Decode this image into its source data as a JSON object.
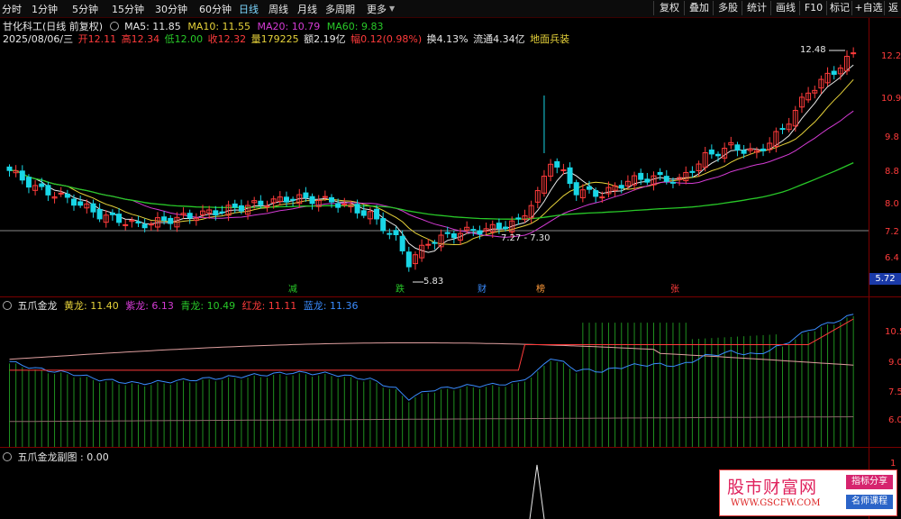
{
  "toolbar": {
    "periods": [
      "分时",
      "1分钟",
      "5分钟",
      "15分钟",
      "30分钟",
      "60分钟",
      "日线",
      "周线",
      "月线",
      "多周期",
      "更多"
    ],
    "active_period": "日线",
    "right_buttons": [
      "复权",
      "叠加",
      "多股",
      "统计",
      "画线",
      "F10",
      "标记",
      "+自选",
      "返回"
    ]
  },
  "header": {
    "stock": "甘化科工(日线 前复权)",
    "ma5_label": "MA5: 11.85",
    "ma10_label": "MA10: 11.55",
    "ma20_label": "MA20: 10.79",
    "ma60_label": "MA60: 9.83",
    "date": "2025/08/06/三",
    "open": "开12.11",
    "high": "高12.34",
    "low": "低12.00",
    "close": "收12.32",
    "volume": "量179225",
    "amount": "额2.19亿",
    "change": "幅0.12(0.98%)",
    "turnover": "换4.13%",
    "float_cap": "流通4.34亿",
    "signal": "地面兵装"
  },
  "main_chart": {
    "price_axis": [
      "12.2",
      "10.9",
      "9.8",
      "8.8",
      "8.0",
      "7.2",
      "6.4"
    ],
    "current_price_tag": "5.72",
    "annotations": {
      "high": "12.48",
      "low": "5.83",
      "range": "7.27 - 7.30"
    },
    "events": [
      "减",
      "跌",
      "财",
      "榜",
      "张"
    ]
  },
  "indicator": {
    "title": "五爪金龙",
    "yellow": "黄龙: 11.40",
    "purple": "紫龙: 6.13",
    "cyan": "青龙: 10.49",
    "red": "红龙: 11.11",
    "blue": "蓝龙: 11.36",
    "axis": [
      "10.5",
      "9.0",
      "7.5",
      "6.0"
    ]
  },
  "sub_indicator": {
    "title": "五爪金龙副图 : 0.00",
    "axis_top": "1"
  },
  "watermark": {
    "main": "股市财富网",
    "sub": "WWW.GSCFW.COM",
    "tag1": "指标分享",
    "tag2": "名师课程"
  },
  "colors": {
    "up": "#ff3b3b",
    "down": "#19d6e6",
    "ma5": "#e8e8e8",
    "ma10": "#e6d23a",
    "ma20": "#d43bd4",
    "ma60": "#28c828",
    "border": "#7a0000"
  }
}
